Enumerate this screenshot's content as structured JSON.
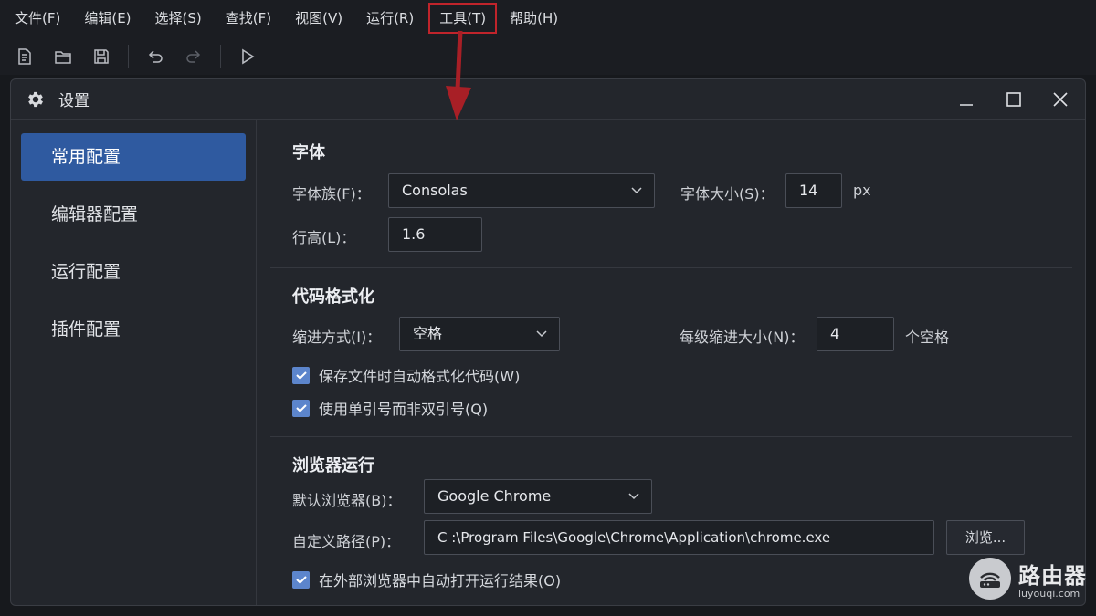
{
  "menubar": {
    "items": [
      {
        "label": "文件(F)"
      },
      {
        "label": "编辑(E)"
      },
      {
        "label": "选择(S)"
      },
      {
        "label": "查找(F)"
      },
      {
        "label": "视图(V)"
      },
      {
        "label": "运行(R)"
      },
      {
        "label": "工具(T)",
        "highlighted": true
      },
      {
        "label": "帮助(H)"
      }
    ]
  },
  "toolbar": {
    "icons": [
      "new-file-icon",
      "open-folder-icon",
      "save-icon",
      "undo-icon",
      "redo-icon",
      "run-icon"
    ],
    "redo_disabled": true
  },
  "annotation": {
    "arrow_color": "#c0242b"
  },
  "dialog": {
    "title": "设置",
    "icon": "gear-icon",
    "controls": [
      "minimize-icon",
      "maximize-icon",
      "close-icon"
    ],
    "sidebar": {
      "items": [
        {
          "label": "常用配置",
          "active": true
        },
        {
          "label": "编辑器配置"
        },
        {
          "label": "运行配置"
        },
        {
          "label": "插件配置"
        }
      ],
      "active_color": "#2f5aa0"
    },
    "font": {
      "title": "字体",
      "family_label": "字体族(F)：",
      "family_value": "Consolas",
      "size_label": "字体大小(S)：",
      "size_value": "14",
      "size_unit": "px",
      "line_height_label": "行高(L)：",
      "line_height_value": "1.6"
    },
    "format": {
      "title": "代码格式化",
      "indent_label": "缩进方式(I)：",
      "indent_value": "空格",
      "indent_size_label": "每级缩进大小(N)：",
      "indent_size_value": "4",
      "indent_size_unit": "个空格",
      "format_on_save_label": "保存文件时自动格式化代码(W)",
      "format_on_save_checked": true,
      "single_quote_label": "使用单引号而非双引号(Q)",
      "single_quote_checked": true
    },
    "browser": {
      "title": "浏览器运行",
      "default_label": "默认浏览器(B)：",
      "default_value": "Google Chrome",
      "path_label": "自定义路径(P)：",
      "path_value": "C :\\Program Files\\Google\\Chrome\\Application\\chrome.exe",
      "browse_label": "浏览...",
      "open_external_label": "在外部浏览器中自动打开运行结果(O)",
      "open_external_checked": true
    },
    "checkbox_color": "#5c85cc"
  },
  "watermark": {
    "name": "路由器",
    "site": "luyouqi.com"
  }
}
